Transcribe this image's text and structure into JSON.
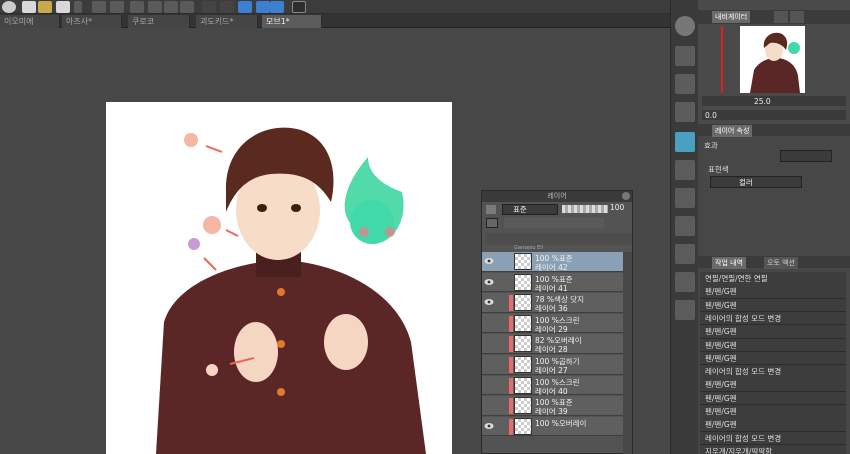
{
  "tabs": [
    {
      "label": "이오미애",
      "active": false
    },
    {
      "label": "아즈사*",
      "active": false
    },
    {
      "label": "쿠로코",
      "active": false
    },
    {
      "label": "괴도키드*",
      "active": false
    },
    {
      "label": "모브1*",
      "active": true
    }
  ],
  "layer_panel": {
    "title": "레이어",
    "blend_mode": "표준",
    "opacity": "100",
    "top_strip": "Gansesu Ell",
    "layers": [
      {
        "line1": "100 %표준",
        "line2": "레이어 42",
        "selected": true,
        "visible": true,
        "clip": false
      },
      {
        "line1": "100 %표준",
        "line2": "레이어 41",
        "selected": false,
        "visible": true,
        "clip": false
      },
      {
        "line1": "78 %색상 닷지",
        "line2": "레이어 36",
        "selected": false,
        "visible": true,
        "clip": true
      },
      {
        "line1": "100 %스크린",
        "line2": "레이어 29",
        "selected": false,
        "visible": false,
        "clip": true
      },
      {
        "line1": "82 %오버레이",
        "line2": "레이어 28",
        "selected": false,
        "visible": false,
        "clip": true
      },
      {
        "line1": "100 %곱하기",
        "line2": "레이어 27",
        "selected": false,
        "visible": false,
        "clip": true
      },
      {
        "line1": "100 %스크린",
        "line2": "레이어 40",
        "selected": false,
        "visible": false,
        "clip": true
      },
      {
        "line1": "100 %표준",
        "line2": "레이어 39",
        "selected": false,
        "visible": false,
        "clip": true
      },
      {
        "line1": "100 %오버레이",
        "line2": "",
        "selected": false,
        "visible": true,
        "clip": true
      }
    ]
  },
  "navigator": {
    "tabs": [
      "내비게이터"
    ],
    "zoom": "25.0",
    "angle": "0.0"
  },
  "properties": {
    "tab": "레이어 속성",
    "effect_label": "효과",
    "expression_label": "표현색",
    "expression_value": "컬러"
  },
  "history": {
    "tab": "작업 내역",
    "tab2": "오토 액션",
    "items": [
      "연필/연필/연한 연필",
      "펜/펜/G펜",
      "펜/펜/G펜",
      "레이어의 합성 모드 변경",
      "펜/펜/G펜",
      "펜/펜/G펜",
      "펜/펜/G펜",
      "레이어의 합성 모드 변경",
      "펜/펜/G펜",
      "펜/펜/G펜",
      "펜/펜/G펜",
      "펜/펜/G펜",
      "레이어의 합성 모드 변경",
      "지우개/지우개/딱딱함"
    ]
  },
  "colors": {
    "accent": "#3d7fd1",
    "selected_layer": "#8aa0b4",
    "clip_marker": "#e86a6a"
  }
}
